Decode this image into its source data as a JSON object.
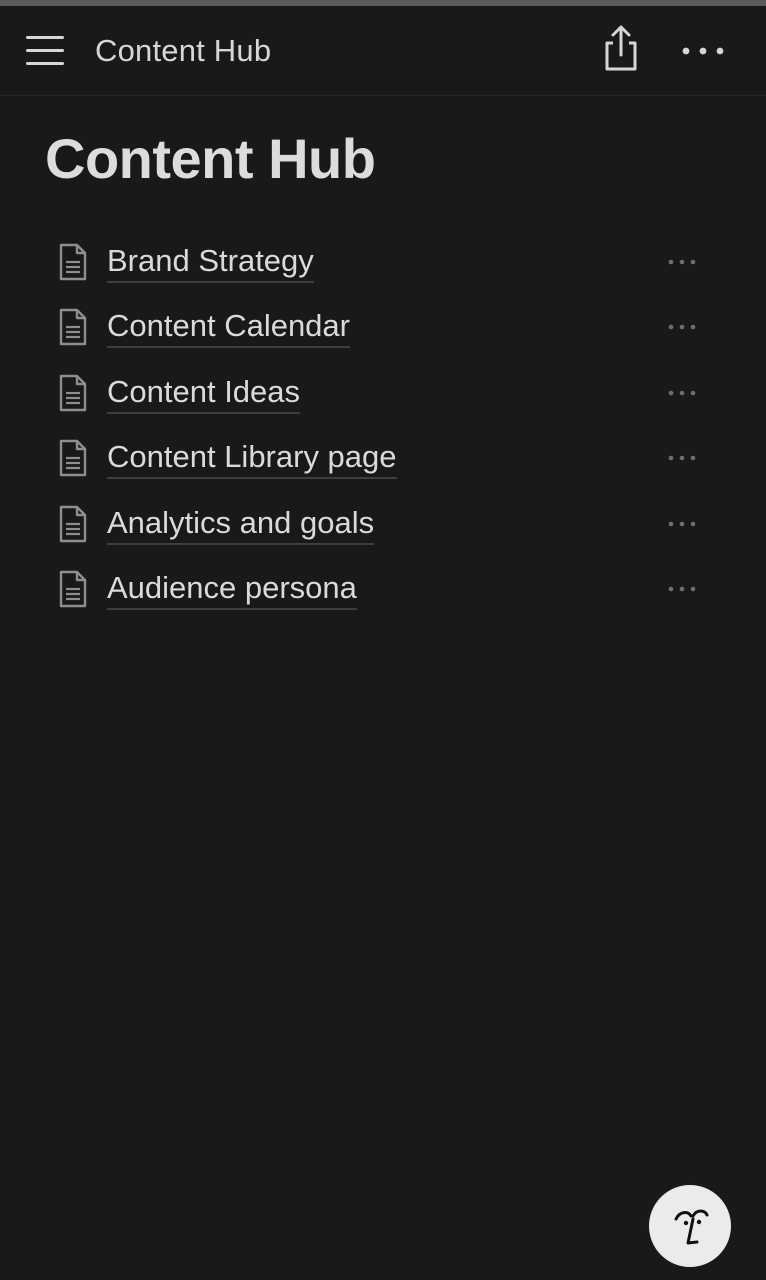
{
  "header": {
    "title": "Content Hub",
    "icons": [
      "menu-icon",
      "share-icon",
      "more-horizontal-icon"
    ]
  },
  "page": {
    "title": "Content Hub"
  },
  "pages": [
    {
      "label": "Brand Strategy",
      "icon": "document-icon"
    },
    {
      "label": "Content Calendar",
      "icon": "document-icon"
    },
    {
      "label": "Content Ideas",
      "icon": "document-icon"
    },
    {
      "label": "Content Library page",
      "icon": "document-icon"
    },
    {
      "label": "Analytics and goals",
      "icon": "document-icon"
    },
    {
      "label": "Audience persona",
      "icon": "document-icon"
    }
  ],
  "fab": {
    "icon": "ai-face-icon"
  },
  "colors": {
    "background": "#191919",
    "text": "#dadada",
    "icon": "#8e8e8e",
    "fab_background": "#ebebeb"
  }
}
